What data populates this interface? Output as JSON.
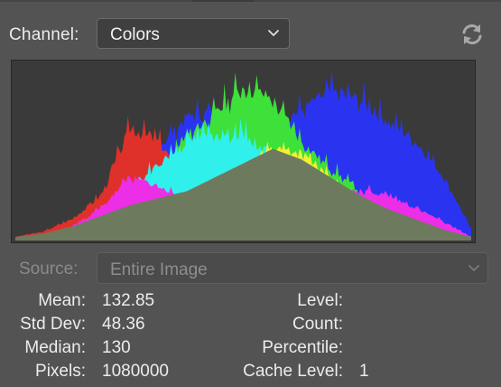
{
  "channel": {
    "label": "Channel:",
    "selected": "Colors"
  },
  "source": {
    "label": "Source:",
    "selected": "Entire Image"
  },
  "stats_left": [
    {
      "label": "Mean:",
      "value": "132.85"
    },
    {
      "label": "Std Dev:",
      "value": "48.36"
    },
    {
      "label": "Median:",
      "value": "130"
    },
    {
      "label": "Pixels:",
      "value": "1080000"
    }
  ],
  "stats_right": [
    {
      "label": "Level:",
      "value": ""
    },
    {
      "label": "Count:",
      "value": ""
    },
    {
      "label": "Percentile:",
      "value": ""
    },
    {
      "label": "Cache Level:",
      "value": "1"
    }
  ],
  "icons": {
    "refresh": "refresh-icon",
    "chevron": "chevron-down-icon"
  },
  "colors": {
    "panel_bg": "#535353",
    "histogram_bg": "#3a3a3a",
    "red": "#e0302a",
    "green": "#3ee03a",
    "blue": "#2a34f0",
    "cyan": "#30f0ec",
    "magenta": "#ec2ee6",
    "yellow": "#f2f032",
    "luminosity": "#6e7a5e"
  },
  "chart_data": {
    "type": "area",
    "x": [
      0,
      16,
      32,
      48,
      64,
      80,
      96,
      112,
      128,
      144,
      160,
      176,
      192,
      208,
      224,
      240,
      255
    ],
    "xlim": [
      0,
      255
    ],
    "ylim": [
      0,
      1
    ],
    "grid": false,
    "series": [
      {
        "values": [
          0.02,
          0.05,
          0.12,
          0.25,
          0.62,
          0.55,
          0.33,
          0.2,
          0.1,
          0.06,
          0.04,
          0.03,
          0.02,
          0.02,
          0.01,
          0.01,
          0.01
        ]
      },
      {
        "values": [
          0.01,
          0.02,
          0.03,
          0.05,
          0.15,
          0.36,
          0.58,
          0.7,
          0.86,
          0.78,
          0.55,
          0.4,
          0.28,
          0.18,
          0.1,
          0.05,
          0.02
        ]
      },
      {
        "values": [
          0.02,
          0.04,
          0.08,
          0.16,
          0.3,
          0.52,
          0.68,
          0.72,
          0.7,
          0.64,
          0.72,
          0.82,
          0.78,
          0.66,
          0.55,
          0.35,
          0.06
        ]
      },
      {
        "values": [
          0.0,
          0.02,
          0.05,
          0.12,
          0.28,
          0.42,
          0.55,
          0.6,
          0.58,
          0.48,
          0.35,
          0.2,
          0.1,
          0.06,
          0.03,
          0.02,
          0.01
        ]
      },
      {
        "values": [
          0.01,
          0.03,
          0.08,
          0.18,
          0.35,
          0.3,
          0.22,
          0.15,
          0.1,
          0.1,
          0.15,
          0.22,
          0.28,
          0.25,
          0.18,
          0.1,
          0.02
        ]
      },
      {
        "values": [
          0.0,
          0.01,
          0.02,
          0.03,
          0.05,
          0.08,
          0.14,
          0.22,
          0.38,
          0.52,
          0.48,
          0.34,
          0.2,
          0.1,
          0.05,
          0.02,
          0.01
        ]
      },
      {
        "values": [
          0.02,
          0.04,
          0.08,
          0.14,
          0.2,
          0.24,
          0.28,
          0.36,
          0.44,
          0.52,
          0.46,
          0.36,
          0.26,
          0.18,
          0.12,
          0.06,
          0.02
        ]
      }
    ]
  }
}
